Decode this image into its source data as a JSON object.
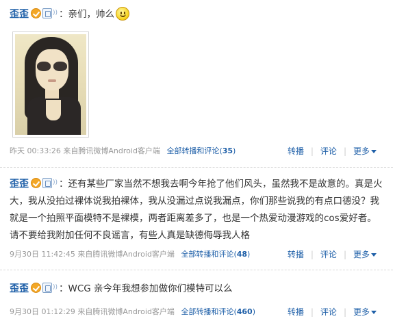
{
  "posts": [
    {
      "user": "歪歪",
      "text": "亲们，帅么",
      "time": "昨天 00:33:26",
      "via": "来自腾讯微博Android客户端",
      "all_rt_label": "全部转播和评论",
      "count": "35"
    },
    {
      "user": "歪歪",
      "text": "还有某些厂家当然不想我去啊今年抢了他们风头，虽然我不是故意的。真是火大，我从没拍过裸体说我拍裸体，我从没漏过点说我漏点，你们那些说我的有点口德没？我就是一个拍照平面模特不是裸模，两者距离差多了，也是一个热爱动漫游戏的cos爱好者。请不要给我附加任何不良谣言，有些人真是缺德侮辱我人格",
      "time": "9月30日 11:42:45",
      "via": "来自腾讯微博Android客户端",
      "all_rt_label": "全部转播和评论",
      "count": "48"
    },
    {
      "user": "歪歪",
      "text": "WCG 亲今年我想参加做你们模特可以么",
      "time": "9月30日 01:12:29",
      "via": "来自腾讯微博Android客户端",
      "all_rt_label": "全部转播和评论",
      "count": "460"
    }
  ],
  "actions": {
    "rebroadcast": "转播",
    "comment": "评论",
    "more": "更多"
  },
  "icons": [
    "verified-badge-icon",
    "android-device-icon",
    "smiley-emoji-icon",
    "dropdown-caret-icon"
  ],
  "colors": {
    "link": "#1e5fa8",
    "meta": "#999999",
    "badge": "#f3a726"
  }
}
